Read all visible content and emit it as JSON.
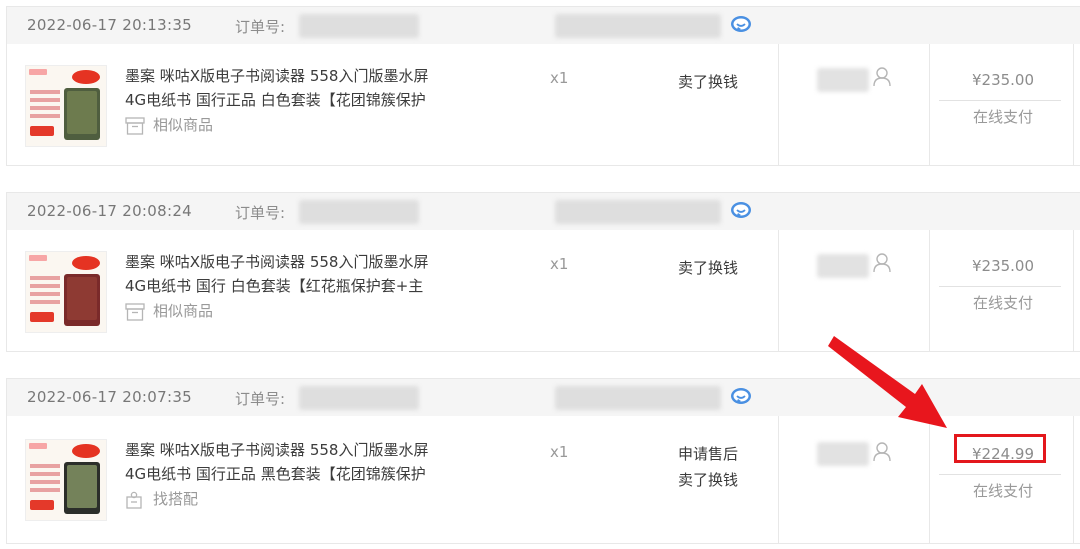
{
  "orders": [
    {
      "date": "2022-06-17 20:13:35",
      "order_no_label": "订单号:",
      "product_title_line1": "墨案 咪咕X版电子书阅读器 558入门版墨水屏",
      "product_title_line2": "4G电纸书 国行正品 白色套装【花团锦簇保护",
      "secondary_action": "相似商品",
      "secondary_icon": "box-icon",
      "quantity": "x1",
      "actions": [
        "卖了换钱"
      ],
      "price": "¥235.00",
      "payment": "在线支付",
      "cover_color": "green"
    },
    {
      "date": "2022-06-17 20:08:24",
      "order_no_label": "订单号:",
      "product_title_line1": "墨案 咪咕X版电子书阅读器 558入门版墨水屏",
      "product_title_line2": "4G电纸书 国行 白色套装【红花瓶保护套+主",
      "secondary_action": "相似商品",
      "secondary_icon": "box-icon",
      "quantity": "x1",
      "actions": [
        "卖了换钱"
      ],
      "price": "¥235.00",
      "payment": "在线支付",
      "cover_color": "red"
    },
    {
      "date": "2022-06-17 20:07:35",
      "order_no_label": "订单号:",
      "product_title_line1": "墨案 咪咕X版电子书阅读器 558入门版墨水屏",
      "product_title_line2": "4G电纸书 国行正品 黑色套装【花团锦簇保护",
      "secondary_action": "找搭配",
      "secondary_icon": "match-icon",
      "quantity": "x1",
      "actions": [
        "申请售后",
        "卖了换钱"
      ],
      "price": "¥224.99",
      "payment": "在线支付",
      "cover_color": "black",
      "highlighted": true
    }
  ],
  "colors": {
    "header_bg": "#f5f5f5",
    "highlight": "#e3171c",
    "chat_icon": "#4a90e2"
  }
}
